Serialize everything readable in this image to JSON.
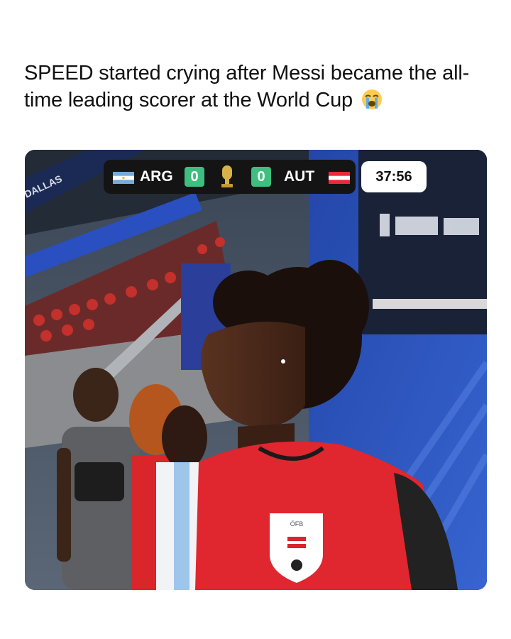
{
  "post": {
    "caption": "SPEED started crying after Messi became the all-time leading scorer at the World Cup",
    "caption_emoji": "loudly-crying-face-emoji"
  },
  "scoreboard": {
    "home_team": "ARG",
    "home_score": "0",
    "away_team": "AUT",
    "away_score": "0",
    "match_clock": "37:56",
    "home_flag": "argentina-flag-icon",
    "away_flag": "austria-flag-icon",
    "tournament_logo": "world-cup-trophy-icon",
    "score_box_color": "#3fbf7f"
  },
  "photo": {
    "stadium_sign": "DALLAS",
    "jersey_crest": "ÖFB"
  }
}
